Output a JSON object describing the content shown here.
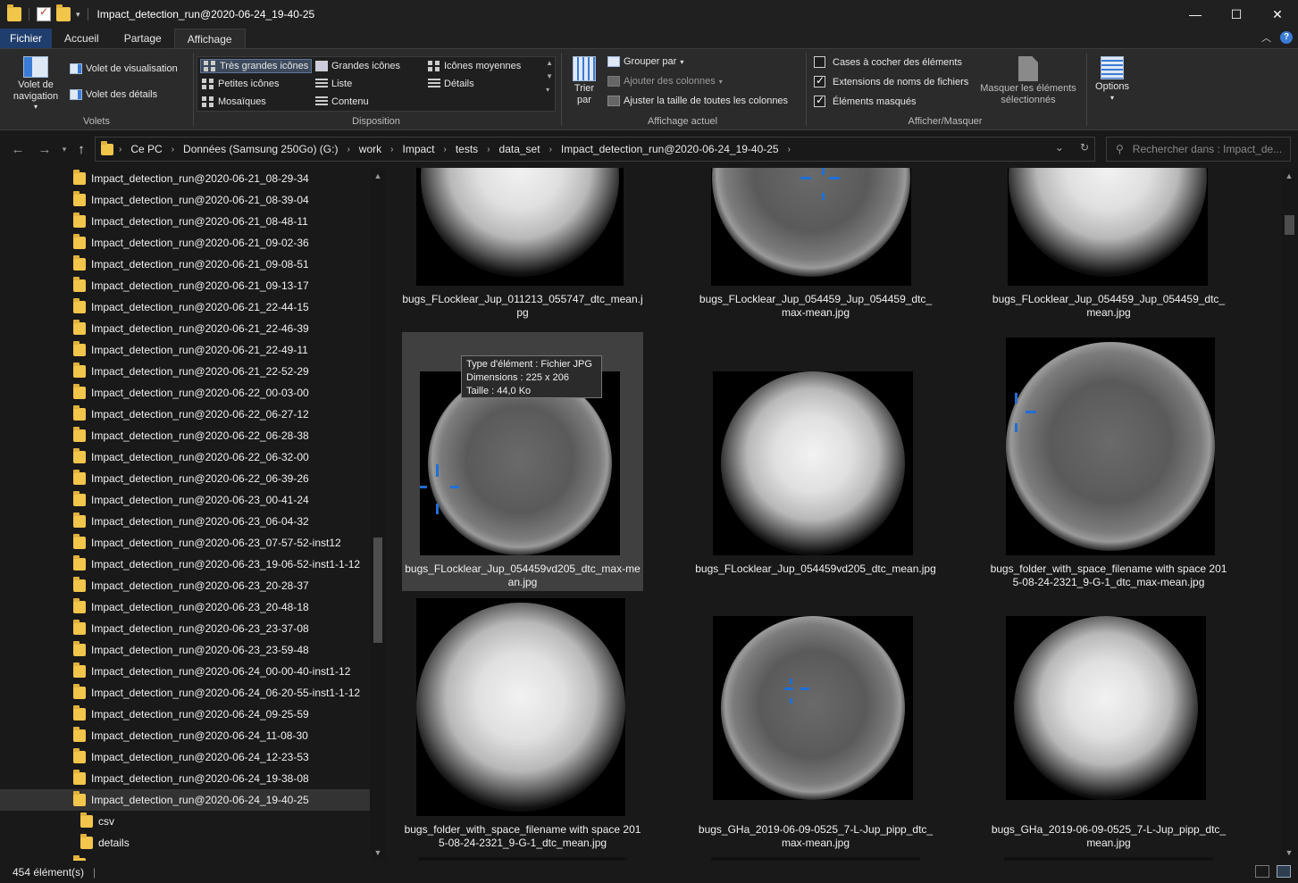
{
  "window": {
    "title": "Impact_detection_run@2020-06-24_19-40-25",
    "minimize": "—",
    "maximize": "☐",
    "close": "✕"
  },
  "ribbon_tabs": [
    "Fichier",
    "Accueil",
    "Partage",
    "Affichage"
  ],
  "active_tab": "Affichage",
  "ribbon": {
    "volets": {
      "label": "Volets",
      "nav_pane": "Volet de navigation",
      "preview": "Volet de visualisation",
      "details": "Volet des détails"
    },
    "disposition": {
      "label": "Disposition",
      "items": [
        "Très grandes icônes",
        "Grandes icônes",
        "Icônes moyennes",
        "Petites icônes",
        "Liste",
        "Détails",
        "Mosaïques",
        "Contenu"
      ],
      "selected": "Très grandes icônes"
    },
    "affichage_actuel": {
      "label": "Affichage actuel",
      "sort": "Trier par",
      "group": "Grouper par",
      "add_columns": "Ajouter des colonnes",
      "fit_columns": "Ajuster la taille de toutes les colonnes"
    },
    "afficher_masquer": {
      "label": "Afficher/Masquer",
      "checkboxes": [
        {
          "label": "Cases à cocher des éléments",
          "checked": false
        },
        {
          "label": "Extensions de noms de fichiers",
          "checked": true
        },
        {
          "label": "Éléments masqués",
          "checked": true
        }
      ],
      "hide_selected": "Masquer les éléments sélectionnés"
    },
    "options": "Options"
  },
  "address": {
    "crumbs": [
      "Ce PC",
      "Données (Samsung 250Go) (G:)",
      "work",
      "Impact",
      "tests",
      "data_set",
      "Impact_detection_run@2020-06-24_19-40-25"
    ],
    "search_placeholder": "Rechercher dans : Impact_de..."
  },
  "nav_tree": [
    "Impact_detection_run@2020-06-21_08-29-34",
    "Impact_detection_run@2020-06-21_08-39-04",
    "Impact_detection_run@2020-06-21_08-48-11",
    "Impact_detection_run@2020-06-21_09-02-36",
    "Impact_detection_run@2020-06-21_09-08-51",
    "Impact_detection_run@2020-06-21_09-13-17",
    "Impact_detection_run@2020-06-21_22-44-15",
    "Impact_detection_run@2020-06-21_22-46-39",
    "Impact_detection_run@2020-06-21_22-49-11",
    "Impact_detection_run@2020-06-21_22-52-29",
    "Impact_detection_run@2020-06-22_00-03-00",
    "Impact_detection_run@2020-06-22_06-27-12",
    "Impact_detection_run@2020-06-22_06-28-38",
    "Impact_detection_run@2020-06-22_06-32-00",
    "Impact_detection_run@2020-06-22_06-39-26",
    "Impact_detection_run@2020-06-23_00-41-24",
    "Impact_detection_run@2020-06-23_06-04-32",
    "Impact_detection_run@2020-06-23_07-57-52-inst12",
    "Impact_detection_run@2020-06-23_19-06-52-inst1-1-12",
    "Impact_detection_run@2020-06-23_20-28-37",
    "Impact_detection_run@2020-06-23_20-48-18",
    "Impact_detection_run@2020-06-23_23-37-08",
    "Impact_detection_run@2020-06-23_23-59-48",
    "Impact_detection_run@2020-06-24_00-00-40-inst1-12",
    "Impact_detection_run@2020-06-24_06-20-55-inst1-1-12",
    "Impact_detection_run@2020-06-24_09-25-59",
    "Impact_detection_run@2020-06-24_11-08-30",
    "Impact_detection_run@2020-06-24_12-23-53",
    "Impact_detection_run@2020-06-24_19-38-08",
    "Impact_detection_run@2020-06-24_19-40-25"
  ],
  "nav_selected": "Impact_detection_run@2020-06-24_19-40-25",
  "nav_children": [
    "csv",
    "details"
  ],
  "files": [
    {
      "name": "bugs_FLocklear_Jup_011213_055747_dtc_mean.jpg",
      "kind": "mean"
    },
    {
      "name": "bugs_FLocklear_Jup_054459_Jup_054459_dtc_max-mean.jpg",
      "kind": "maxmean"
    },
    {
      "name": "bugs_FLocklear_Jup_054459_Jup_054459_dtc_mean.jpg",
      "kind": "mean"
    },
    {
      "name": "bugs_FLocklear_Jup_054459vd205_dtc_max-mean.jpg",
      "kind": "maxmean"
    },
    {
      "name": "bugs_FLocklear_Jup_054459vd205_dtc_mean.jpg",
      "kind": "mean"
    },
    {
      "name": "bugs_folder_with_space_filename with space 2015-08-24-2321_9-G-1_dtc_max-mean.jpg",
      "kind": "maxmean"
    },
    {
      "name": "bugs_folder_with_space_filename with space 2015-08-24-2321_9-G-1_dtc_mean.jpg",
      "kind": "mean"
    },
    {
      "name": "bugs_GHa_2019-06-09-0525_7-L-Jup_pipp_dtc_max-mean.jpg",
      "kind": "maxmean"
    },
    {
      "name": "bugs_GHa_2019-06-09-0525_7-L-Jup_pipp_dtc_mean.jpg",
      "kind": "mean"
    }
  ],
  "tooltip": {
    "type": "Type d'élément : Fichier JPG",
    "dimensions": "Dimensions : 225 x 206",
    "size": "Taille : 44,0 Ko"
  },
  "status": {
    "count": "454 élément(s)"
  },
  "colors": {
    "accent": "#1f3e6e",
    "marker": "#1f6fd6",
    "folder": "#f2c54b"
  }
}
